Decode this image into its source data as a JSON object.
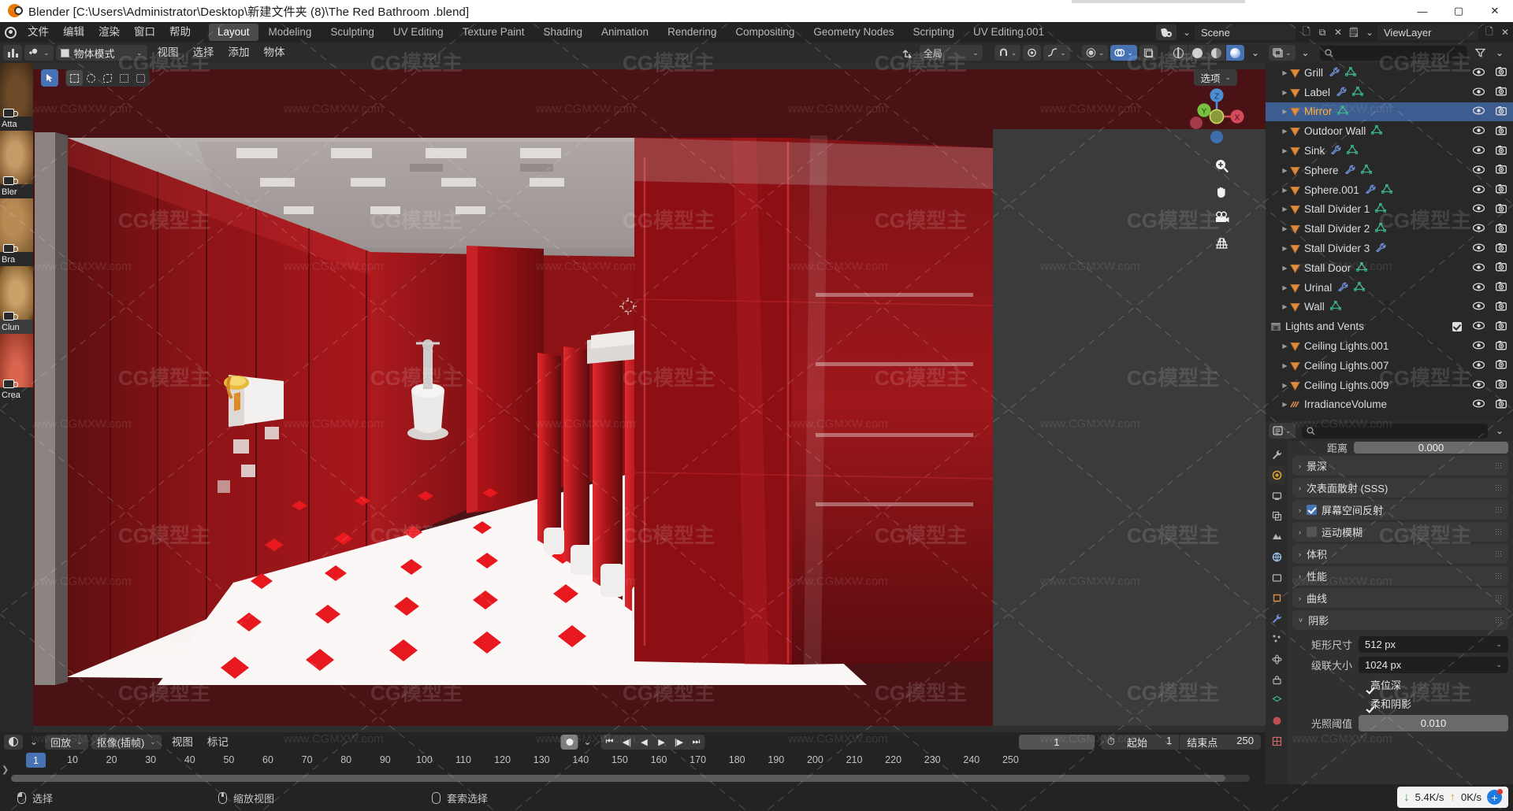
{
  "window": {
    "title": "Blender [C:\\Users\\Administrator\\Desktop\\新建文件夹 (8)\\The Red Bathroom .blend]",
    "minimize": "—",
    "maximize": "▢",
    "close": "✕"
  },
  "topbar": {
    "menus": [
      "文件",
      "编辑",
      "渲染",
      "窗口",
      "帮助"
    ],
    "workspaces": [
      {
        "label": "Layout",
        "active": true
      },
      {
        "label": "Modeling",
        "active": false
      },
      {
        "label": "Sculpting",
        "active": false
      },
      {
        "label": "UV Editing",
        "active": false
      },
      {
        "label": "Texture Paint",
        "active": false
      },
      {
        "label": "Shading",
        "active": false
      },
      {
        "label": "Animation",
        "active": false
      },
      {
        "label": "Rendering",
        "active": false
      },
      {
        "label": "Compositing",
        "active": false
      },
      {
        "label": "Geometry Nodes",
        "active": false
      },
      {
        "label": "Scripting",
        "active": false
      },
      {
        "label": "UV Editing.001",
        "active": false
      }
    ],
    "scene_name": "Scene",
    "view_layer_name": "ViewLayer"
  },
  "viewport_header": {
    "mode": "物体模式",
    "menus": [
      "视图",
      "选择",
      "添加",
      "物体"
    ],
    "transform_orientation": "全局",
    "options": "选项"
  },
  "viewport": {
    "gizmo_axes": [
      "Z",
      "Y",
      "X"
    ],
    "nav_icons": [
      "zoom-icon",
      "hand-icon",
      "camera-icon",
      "grid-icon"
    ]
  },
  "left_shelf": {
    "items": [
      {
        "label": "Atta"
      },
      {
        "label": "Bler"
      },
      {
        "label": "Bra"
      },
      {
        "label": "Clun",
        "selected": true
      },
      {
        "label": "Crea"
      }
    ]
  },
  "outliner": {
    "search_placeholder": "",
    "rows": [
      {
        "name": "Grill",
        "type": "mesh",
        "indent": 1,
        "selected": false,
        "modifier": true,
        "data": true
      },
      {
        "name": "Label",
        "type": "mesh",
        "indent": 1,
        "selected": false,
        "modifier": true,
        "data": true
      },
      {
        "name": "Mirror",
        "type": "mesh",
        "indent": 1,
        "selected": true,
        "modifier": false,
        "data": true
      },
      {
        "name": "Outdoor Wall",
        "type": "mesh",
        "indent": 1,
        "selected": false,
        "modifier": false,
        "data": true
      },
      {
        "name": "Sink",
        "type": "mesh",
        "indent": 1,
        "selected": false,
        "modifier": true,
        "data": true
      },
      {
        "name": "Sphere",
        "type": "mesh",
        "indent": 1,
        "selected": false,
        "modifier": true,
        "data": true
      },
      {
        "name": "Sphere.001",
        "type": "mesh",
        "indent": 1,
        "selected": false,
        "modifier": true,
        "data": true
      },
      {
        "name": "Stall Divider 1",
        "type": "mesh",
        "indent": 1,
        "selected": false,
        "modifier": false,
        "data": true
      },
      {
        "name": "Stall Divider 2",
        "type": "mesh",
        "indent": 1,
        "selected": false,
        "modifier": false,
        "data": true
      },
      {
        "name": "Stall Divider 3",
        "type": "mesh",
        "indent": 1,
        "selected": false,
        "modifier": true,
        "data": false
      },
      {
        "name": "Stall Door",
        "type": "mesh",
        "indent": 1,
        "selected": false,
        "modifier": false,
        "data": true
      },
      {
        "name": "Urinal",
        "type": "mesh",
        "indent": 1,
        "selected": false,
        "modifier": true,
        "data": true
      },
      {
        "name": "Wall",
        "type": "mesh",
        "indent": 1,
        "selected": false,
        "modifier": false,
        "data": true
      },
      {
        "name": "Lights and Vents",
        "type": "collection",
        "indent": 0,
        "selected": false,
        "checkbox": true
      },
      {
        "name": "Ceiling Lights.001",
        "type": "mesh",
        "indent": 1,
        "selected": false,
        "modifier": false,
        "data": false
      },
      {
        "name": "Ceiling Lights.007",
        "type": "mesh",
        "indent": 1,
        "selected": false,
        "modifier": false,
        "data": false
      },
      {
        "name": "Ceiling Lights.009",
        "type": "mesh",
        "indent": 1,
        "selected": false,
        "modifier": false,
        "data": false
      },
      {
        "name": "IrradianceVolume",
        "type": "volume",
        "indent": 1,
        "selected": false,
        "modifier": false,
        "data": false
      }
    ]
  },
  "properties": {
    "search_placeholder": "",
    "clipped_top": {
      "label": "距离",
      "value": "0.000"
    },
    "panels": [
      {
        "label": "景深",
        "expanded": false,
        "checkbox": null
      },
      {
        "label": "次表面散射 (SSS)",
        "expanded": false,
        "checkbox": null
      },
      {
        "label": "屏幕空间反射",
        "expanded": false,
        "checkbox": true
      },
      {
        "label": "运动模糊",
        "expanded": false,
        "checkbox": false
      },
      {
        "label": "体积",
        "expanded": false,
        "checkbox": null
      },
      {
        "label": "性能",
        "expanded": false,
        "checkbox": null
      },
      {
        "label": "曲线",
        "expanded": false,
        "checkbox": null
      },
      {
        "label": "阴影",
        "expanded": true,
        "checkbox": null
      }
    ],
    "shadow_settings": {
      "cube_size_label": "矩形尺寸",
      "cube_size_value": "512 px",
      "cascade_size_label": "级联大小",
      "cascade_size_value": "1024 px",
      "high_bitdepth_label": "高位深",
      "high_bitdepth_checked": true,
      "soft_shadows_label": "柔和阴影",
      "soft_shadows_checked": true,
      "light_threshold_label": "光照阈值",
      "light_threshold_value": "0.010"
    }
  },
  "timeline": {
    "menus": [
      "回放",
      "抠像(插帧)",
      "视图",
      "标记"
    ],
    "current_frame": "1",
    "start_label": "起始",
    "start_value": "1",
    "end_label": "结束点",
    "end_value": "250",
    "playhead_frame": "1",
    "ticks": [
      10,
      20,
      30,
      40,
      50,
      60,
      70,
      80,
      90,
      100,
      110,
      120,
      130,
      140,
      150,
      160,
      170,
      180,
      190,
      200,
      210,
      220,
      230,
      240,
      250
    ]
  },
  "statusbar": {
    "select_label": "选择",
    "zoom_label": "缩放视图",
    "lasso_label": "套索选择",
    "download_speed": "5.4K/s",
    "upload_speed": "0K/s"
  },
  "watermarks": {
    "text": "www.CGMXW.com",
    "logo": "CG模型主"
  },
  "colors": {
    "accent_blue": "#4772b3",
    "selected_orange": "#ffae34",
    "mesh_orange": "#e08a3c",
    "data_green": "#3bb08a",
    "modifier_blue": "#6d8fd4",
    "bg_dark": "#232323",
    "panel": "#303030"
  }
}
